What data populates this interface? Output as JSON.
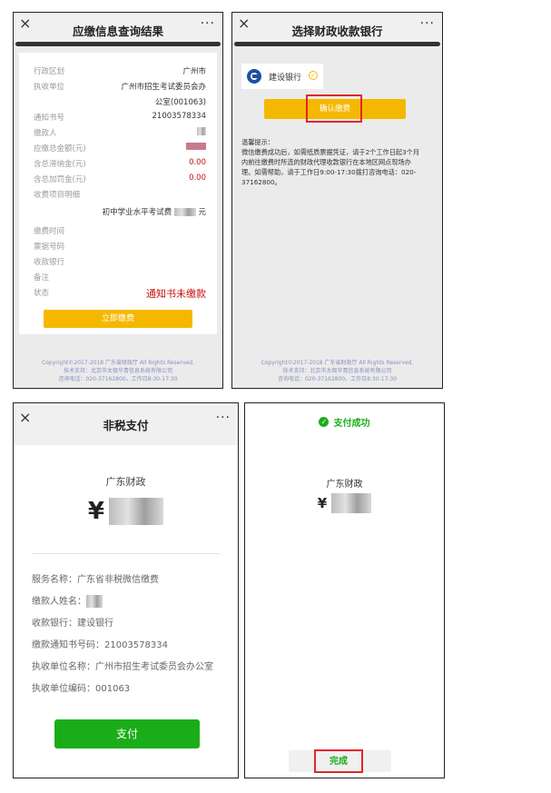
{
  "panel1": {
    "close": "×",
    "title": "应缴信息查询结果",
    "more": "···",
    "rows": [
      {
        "label": "行政区划",
        "value": "广州市"
      },
      {
        "label": "执收单位",
        "value": "广州市招生考试委员会办"
      },
      {
        "label": "",
        "value": "公室(001063)"
      },
      {
        "label": "通知书号",
        "value": "21003578334"
      },
      {
        "label": "缴款人",
        "value": ""
      },
      {
        "label": "应缴总金额(元)",
        "value": ""
      },
      {
        "label": "含总滞纳金(元)",
        "value": "0.00"
      },
      {
        "label": "含总加罚金(元)",
        "value": "0.00"
      },
      {
        "label": "收费项目明细",
        "value": ""
      }
    ],
    "item_prefix": "初中学业水平考试费",
    "item_suffix": "元",
    "rows2": [
      {
        "label": "缴费时间",
        "value": ""
      },
      {
        "label": "票据号码",
        "value": ""
      },
      {
        "label": "收款银行",
        "value": ""
      },
      {
        "label": "备注",
        "value": ""
      }
    ],
    "status_label": "状态",
    "status_value": "通知书未缴款",
    "pay_button": "立即缴费",
    "footer": [
      "Copyright©2017-2018 广东省财政厅 All Rights Reserved.",
      "技术支持：北京市太极华青信息系统有限公司",
      "咨询电话：020-37162800。工作日8:30-17:30"
    ]
  },
  "panel2": {
    "close": "×",
    "title": "选择财政收款银行",
    "more": "···",
    "bank_name": "建设银行",
    "confirm_button": "确认缴费",
    "notice_title": "温馨提示：",
    "notice_lines": [
      "微信缴费成功后，如需纸质票据凭证，请于2个工作日起3个月",
      "内前往缴费时所选的财政代理收款银行在本地区网点现场办",
      "理。如需帮助，请于工作日9:00-17:30拨打咨询电话：020-",
      "37162800。"
    ],
    "footer": [
      "Copyright©2017-2018 广东省财政厅 All Rights Reserved.",
      "技术支持：北京市太极华青信息系统有限公司",
      "咨询电话：020-37162800。工作日8:30-17:30"
    ]
  },
  "panel3": {
    "close": "×",
    "title": "非税支付",
    "more": "···",
    "merchant": "广东财政",
    "currency": "¥",
    "details": [
      "服务名称：广东省非税微信缴费",
      "缴款人姓名：",
      "收款银行：建设银行",
      "缴款通知书号码：21003578334",
      "执收单位名称：广州市招生考试委员会办公室",
      "执收单位编码：001063"
    ],
    "pay_button": "支付"
  },
  "panel4": {
    "status": "支付成功",
    "merchant": "广东财政",
    "currency": "¥",
    "done_button": "完成"
  },
  "colors": {
    "yellow": "#f5b800",
    "green": "#1aad19",
    "red_box": "#e0262b",
    "red_text": "#c81010"
  }
}
